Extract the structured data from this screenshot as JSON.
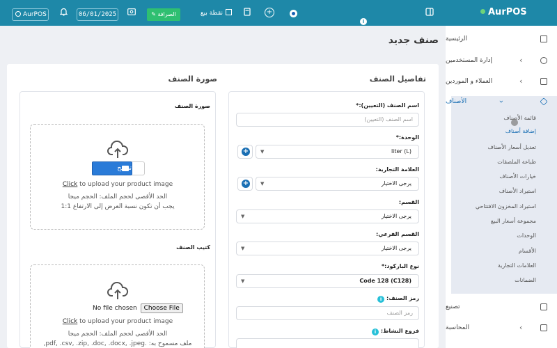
{
  "topbar": {
    "brand": "AurPOS",
    "pos_label": "نقطة بيع",
    "cash_label": "الصرافة",
    "date": "06/01/2025",
    "user": "AurPOS"
  },
  "sidebar": {
    "items": [
      {
        "label": "الرئيسية"
      },
      {
        "label": "إدارة المستخدمين"
      },
      {
        "label": "العملاء و الموردين"
      },
      {
        "label": "الأصناف"
      },
      {
        "label": "تصنيع"
      },
      {
        "label": "المحاسبة"
      }
    ],
    "sub_items": [
      "قائمة الأصناف",
      "إضافة أصناف",
      "تعديل أسعار الأصناف",
      "طباعة الملصقات",
      "خيارات الأصناف",
      "استيراد الأصناف",
      "استيراد المخزون الافتتاحي",
      "مجموعة أسعار البيع",
      "الوحدات",
      "الأقسام",
      "العلامات التجارية",
      "الضمانات"
    ]
  },
  "page": {
    "title": "صنف جديد",
    "details_title": "تفاصيل الصنف",
    "image_title": "صورة الصنف"
  },
  "form": {
    "name_label": "اسم الصنف (التعيين):*",
    "name_placeholder": "اسم الصنف (التعيين)",
    "unit_label": "الوحدة:*",
    "unit_value": "liter (L)",
    "brand_label": "العلامة التجارية:",
    "brand_value": "يرجى الاختيار",
    "category_label": "القسم:",
    "category_value": "يرجى الاختيار",
    "subcategory_label": "القسم الفرعي:",
    "subcategory_value": "يرجى الاختيار",
    "barcode_label": "نوع الباركود:*",
    "barcode_value": "Code 128 (C128)",
    "sku_label": "رمز الصنف:",
    "sku_placeholder": "رمز الصنف",
    "branches_label": "فروع النشاط:"
  },
  "image_panel": {
    "label": "صورة الصنف",
    "browse": "تصفح",
    "click": "Click",
    "upload_text": " to upload your product image",
    "max_size": "الحد الأقصى لحجم الملف: الحجم ميجا",
    "ratio": "يجب أن تكون نسبة العرض إلى الارتفاع 1:1"
  },
  "brochure_panel": {
    "label": "كتيب الصنف",
    "no_file": "No file chosen",
    "choose_file": "Choose File",
    "click": "Click",
    "upload_text": " to upload your product image",
    "max_size": "الحد الأقصى لحجم الملف: الحجم ميجا",
    "allowed": "ملف مسموح به: .pdf, .csv, .zip, .doc, .docx, .jpeg,"
  }
}
